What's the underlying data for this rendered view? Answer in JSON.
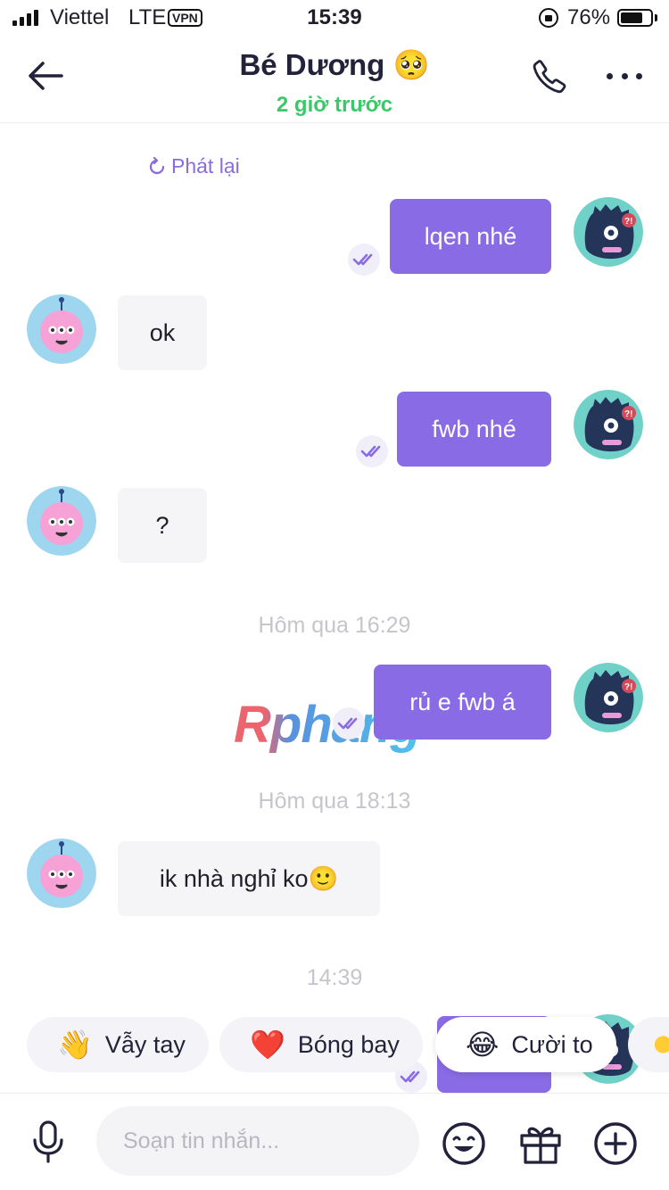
{
  "status_bar": {
    "carrier": "Viettel",
    "network": "LTE",
    "vpn": "VPN",
    "time": "15:39",
    "battery_percent": "76%",
    "battery_level": 0.76
  },
  "header": {
    "title": "Bé Dương 🥺",
    "subtitle": "2 giờ trước"
  },
  "chat": {
    "replay_label": "Phát lại",
    "messages": [
      {
        "direction": "out",
        "text": "lqen nhé"
      },
      {
        "direction": "in",
        "text": "ok"
      },
      {
        "direction": "out",
        "text": "fwb nhé"
      },
      {
        "direction": "in",
        "text": "?"
      },
      {
        "direction": "out",
        "text": "rủ e fwb á"
      },
      {
        "direction": "in",
        "text": "ik nhà nghỉ ko🙂"
      }
    ],
    "timestamps": [
      "Hôm qua 16:29",
      "Hôm qua 18:13",
      "14:39"
    ],
    "watermark": "Rphang"
  },
  "quick_reactions": [
    {
      "emoji": "👋",
      "label": "Vẫy tay"
    },
    {
      "emoji": "❤️",
      "label": "Bóng bay"
    },
    {
      "emoji": "😂",
      "label": "Cười to"
    }
  ],
  "composer": {
    "placeholder": "Soạn tin nhắn..."
  },
  "colors": {
    "accent": "#8a6be6",
    "online_green": "#3cc76a",
    "incoming_bubble": "#f5f5f8"
  }
}
